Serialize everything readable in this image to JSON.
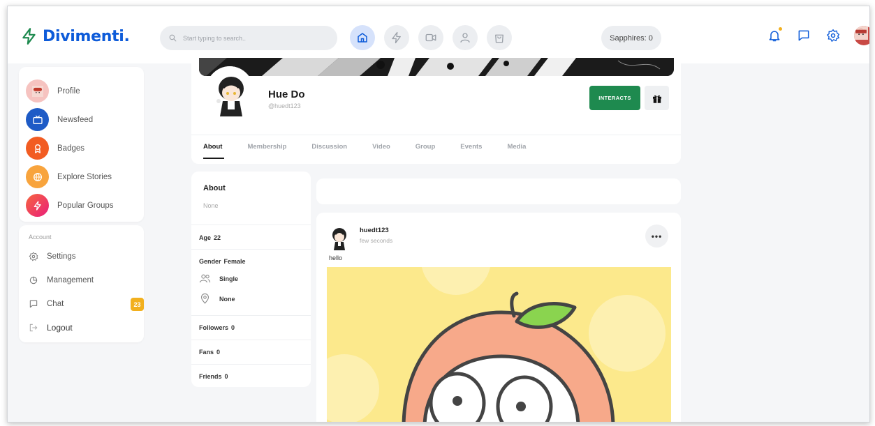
{
  "app": {
    "logo": "Divimenti."
  },
  "search": {
    "placeholder": "Start typing to search.."
  },
  "header": {
    "nav_icons": [
      "home-icon",
      "lightning-icon",
      "video-icon",
      "user-icon",
      "shopping-bag-icon"
    ],
    "sapphires": "Sapphires: 0",
    "right_icons": [
      "bell-icon",
      "message-icon",
      "gear-icon",
      "avatar"
    ]
  },
  "sidebar": {
    "items": [
      {
        "label": "Profile",
        "color": "#f6c3c0",
        "icon": "avatar"
      },
      {
        "label": "Newsfeed",
        "color": "#1e5bc6",
        "icon": "tv-icon"
      },
      {
        "label": "Badges",
        "color": "#f25c22",
        "icon": "award-icon"
      },
      {
        "label": "Explore Stories",
        "color": "#f8a43d",
        "icon": "globe-icon"
      },
      {
        "label": "Popular Groups",
        "color": "#ee2a6b",
        "icon": "lightning-icon"
      }
    ],
    "account": {
      "title": "Account",
      "items": [
        {
          "label": "Settings",
          "icon": "gear-icon"
        },
        {
          "label": "Management",
          "icon": "pie-chart-icon"
        },
        {
          "label": "Chat",
          "icon": "chat-icon",
          "badge": "23"
        },
        {
          "label": "Logout",
          "icon": "logout-icon"
        }
      ]
    }
  },
  "profile": {
    "name": "Hue Do",
    "handle": "@huedt123",
    "interacts_label": "INTERACTS",
    "tabs": [
      "About",
      "Membership",
      "Discussion",
      "Video",
      "Group",
      "Events",
      "Media"
    ],
    "active_tab": "About"
  },
  "about": {
    "title": "About",
    "description": "None",
    "age_label": "Age",
    "age": "22",
    "gender_label": "Gender",
    "gender": "Female",
    "relationship": "Single",
    "location": "None",
    "followers_label": "Followers",
    "followers": "0",
    "fans_label": "Fans",
    "fans": "0",
    "friends_label": "Friends",
    "friends": "0"
  },
  "post": {
    "user": "huedt123",
    "time": "few seconds",
    "text": "hello",
    "menu": "•••"
  },
  "colors": {
    "brand": "#0d5bd9",
    "interacts": "#1e8a4f",
    "badge": "#f2b01e"
  }
}
